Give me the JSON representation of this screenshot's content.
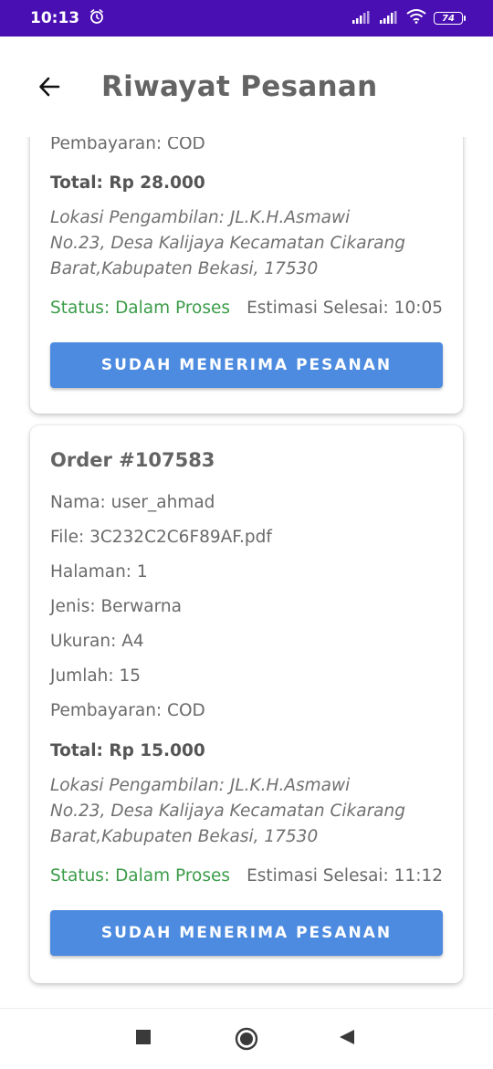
{
  "status_bar": {
    "time": "10:13",
    "battery": "74"
  },
  "app_bar": {
    "title": "Riwayat Pesanan"
  },
  "orders": [
    {
      "payment": "Pembayaran:  COD",
      "total": "Total: Rp 28.000",
      "location_line1": "Lokasi Pengambilan: JL.K.H.Asmawi",
      "location_line2": "No.23, Desa Kalijaya Kecamatan Cikarang",
      "location_line3": "Barat,Kabupaten Bekasi, 17530",
      "status": "Status: Dalam Proses",
      "estimate": "Estimasi Selesai: 10:05",
      "button_label": "SUDAH MENERIMA PESANAN"
    },
    {
      "title": "Order #107583",
      "name": "Nama: user_ahmad",
      "file": "File: 3C232C2C6F89AF.pdf",
      "pages": "Halaman: 1",
      "type": "Jenis: Berwarna",
      "size": "Ukuran: A4",
      "quantity": "Jumlah: 15",
      "payment": "Pembayaran:  COD",
      "total": "Total: Rp 15.000",
      "location_line1": "Lokasi Pengambilan: JL.K.H.Asmawi",
      "location_line2": "No.23, Desa Kalijaya Kecamatan Cikarang",
      "location_line3": "Barat,Kabupaten Bekasi, 17530",
      "status": "Status: Dalam Proses",
      "estimate": "Estimasi Selesai: 11:12",
      "button_label": "SUDAH MENERIMA PESANAN"
    }
  ],
  "colors": {
    "status_bar": "#4a0fb3",
    "status_green": "#3c9c4a",
    "button_blue": "#4c8be0"
  },
  "icons": {
    "back": "arrow-left-icon",
    "alarm": "alarm-icon",
    "signal": "signal-icon",
    "wifi": "wifi-icon",
    "battery": "battery-icon",
    "recents": "square-icon",
    "home": "circle-icon",
    "nav_back": "triangle-back-icon"
  }
}
